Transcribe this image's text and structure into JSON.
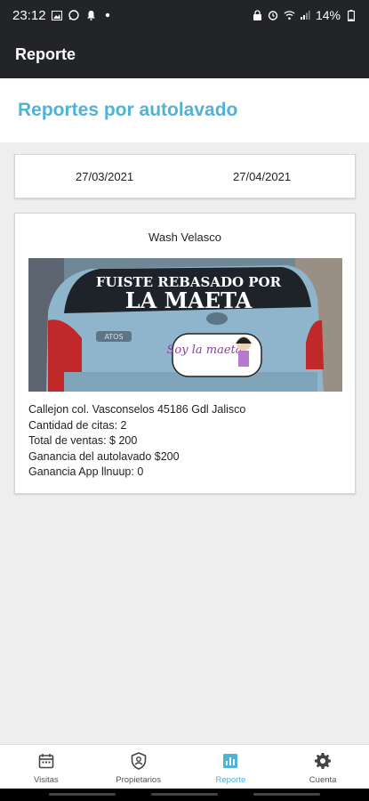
{
  "status_bar": {
    "time": "23:12",
    "battery": "14%"
  },
  "app_bar": {
    "title": "Reporte"
  },
  "header": {
    "title": "Reportes por autolavado"
  },
  "date_range": {
    "start": "27/03/2021",
    "end": "27/04/2021"
  },
  "report": {
    "name": "Wash Velasco",
    "photo_text": {
      "banner_line1": "FUISTE REBASADO POR",
      "banner_line2": "LA MAETA",
      "sticker": "Soy la maeta",
      "car_badge": "ATOS"
    },
    "lines": [
      "Callejon col. Vasconselos 45186 Gdl Jalisco",
      "Cantidad de citas: 2",
      "Total de ventas: $ 200",
      "Ganancia del autolavado $200",
      "Ganancia App llnuup: 0"
    ]
  },
  "bottom_nav": {
    "items": [
      {
        "label": "Visitas",
        "icon": "calendar-icon"
      },
      {
        "label": "Propietarios",
        "icon": "shield-user-icon"
      },
      {
        "label": "Reporte",
        "icon": "bar-chart-icon",
        "active": true
      },
      {
        "label": "Cuenta",
        "icon": "gear-icon"
      }
    ]
  },
  "colors": {
    "accent": "#4fb2d8",
    "appbar": "#222427",
    "background": "#eeeeee"
  }
}
